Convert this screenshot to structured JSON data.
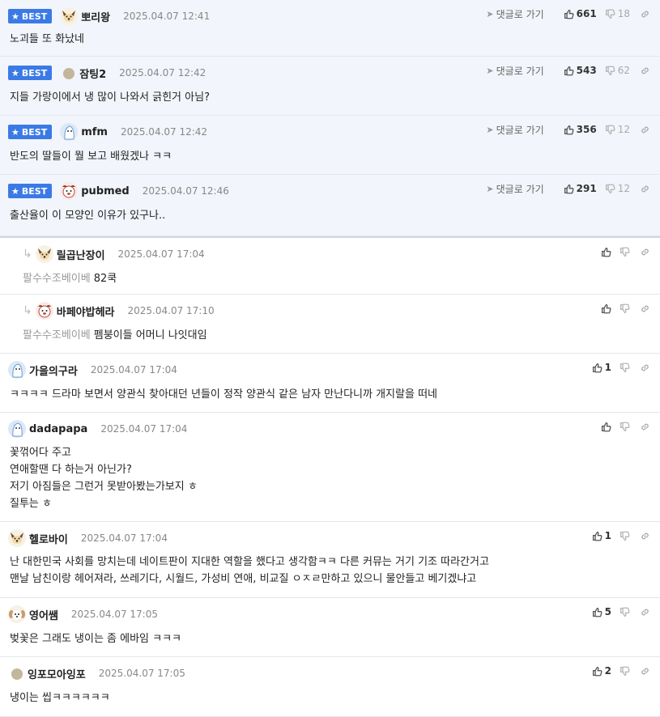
{
  "labels": {
    "best": "BEST",
    "goto": "댓글로 가기"
  },
  "comments": [
    {
      "best": true,
      "reply": false,
      "avatar": "dog-cream-avatar",
      "nick": "뽀리왕",
      "date": "2025.04.07 12:41",
      "lines": [
        "노괴들 또 화났네"
      ],
      "up": "661",
      "down": "18",
      "goto": true
    },
    {
      "best": true,
      "reply": false,
      "avatar": "default-dot-avatar",
      "nick": "잠팅2",
      "date": "2025.04.07 12:42",
      "lines": [
        "지들 가랑이에서 냉 많이 나와서 긁힌거 아님?"
      ],
      "up": "543",
      "down": "62",
      "goto": true
    },
    {
      "best": true,
      "reply": false,
      "avatar": "blue-ghost-avatar",
      "nick": "mfm",
      "date": "2025.04.07 12:42",
      "lines": [
        "반도의 딸들이 뭘 보고 배웠겠나 ㅋㅋ"
      ],
      "up": "356",
      "down": "12",
      "goto": true
    },
    {
      "best": true,
      "reply": false,
      "avatar": "red-dog-avatar",
      "nick": "pubmed",
      "date": "2025.04.07 12:46",
      "lines": [
        "출산율이 이 모양인 이유가 있구나.."
      ],
      "up": "291",
      "down": "12",
      "goto": true
    },
    {
      "best": false,
      "reply": true,
      "avatar": "dog-cream-avatar",
      "nick": "릴곱난장이",
      "date": "2025.04.07 17:04",
      "mention": "팔수수조베이베",
      "lines": [
        "82쿡"
      ],
      "up": "",
      "down": "",
      "goto": false
    },
    {
      "best": false,
      "reply": true,
      "avatar": "red-dog-avatar",
      "nick": "바페야밥헤라",
      "date": "2025.04.07 17:10",
      "mention": "팔수수조베이베",
      "lines": [
        "펨붕이들 어머니 나잇대임"
      ],
      "up": "",
      "down": "",
      "goto": false
    },
    {
      "best": false,
      "reply": false,
      "avatar": "blue-ghost-avatar",
      "nick": "가을의구라",
      "date": "2025.04.07 17:04",
      "lines": [
        "ㅋㅋㅋㅋ 드라마 보면서 양관식 찾아대던 년들이 정작 양관식 같은 남자 만난다니까 개지랄을 떠네"
      ],
      "up": "1",
      "down": "",
      "goto": false
    },
    {
      "best": false,
      "reply": false,
      "avatar": "blue-ghost-avatar",
      "nick": "dadapapa",
      "date": "2025.04.07 17:04",
      "lines": [
        "꽃꺾어다 주고",
        "연애할땐 다 하는거 아닌가?",
        "저기 아짐들은 그런거 못받아봤는가보지 ㅎ",
        "질투는 ㅎ"
      ],
      "up": "",
      "down": "",
      "goto": false
    },
    {
      "best": false,
      "reply": false,
      "avatar": "dog-cream-avatar",
      "nick": "헬로바이",
      "date": "2025.04.07 17:04",
      "lines": [
        "난 대한민국 사회를 망치는데 네이트판이 지대한 역할을 했다고 생각함ㅋㅋ 다른 커뮤는 거기 기조 따라간거고",
        "맨날 남친이랑 헤어져라, 쓰레기다, 시월드, 가성비 연애, 비교질 ㅇㅈㄹ만하고 있으니 물안들고 베기겠냐고"
      ],
      "up": "1",
      "down": "",
      "goto": false
    },
    {
      "best": false,
      "reply": false,
      "avatar": "puppy-avatar",
      "nick": "영어쌤",
      "date": "2025.04.07 17:05",
      "lines": [
        "벚꽃은 그래도 냉이는 좀 에바임 ㅋㅋㅋ"
      ],
      "up": "5",
      "down": "",
      "goto": false
    },
    {
      "best": false,
      "reply": false,
      "avatar": "default-dot-avatar",
      "nick": "잉포모아잉포",
      "date": "2025.04.07 17:05",
      "lines": [
        "냉이는 씹ㅋㅋㅋㅋㅋㅋ"
      ],
      "up": "2",
      "down": "",
      "goto": false
    }
  ]
}
